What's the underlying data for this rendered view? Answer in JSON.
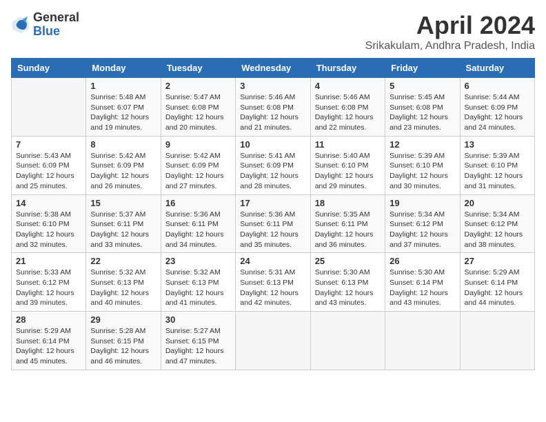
{
  "logo": {
    "general": "General",
    "blue": "Blue"
  },
  "title": "April 2024",
  "subtitle": "Srikakulam, Andhra Pradesh, India",
  "days_of_week": [
    "Sunday",
    "Monday",
    "Tuesday",
    "Wednesday",
    "Thursday",
    "Friday",
    "Saturday"
  ],
  "weeks": [
    [
      {
        "day": "",
        "sunrise": "",
        "sunset": "",
        "daylight": ""
      },
      {
        "day": "1",
        "sunrise": "Sunrise: 5:48 AM",
        "sunset": "Sunset: 6:07 PM",
        "daylight": "Daylight: 12 hours and 19 minutes."
      },
      {
        "day": "2",
        "sunrise": "Sunrise: 5:47 AM",
        "sunset": "Sunset: 6:08 PM",
        "daylight": "Daylight: 12 hours and 20 minutes."
      },
      {
        "day": "3",
        "sunrise": "Sunrise: 5:46 AM",
        "sunset": "Sunset: 6:08 PM",
        "daylight": "Daylight: 12 hours and 21 minutes."
      },
      {
        "day": "4",
        "sunrise": "Sunrise: 5:46 AM",
        "sunset": "Sunset: 6:08 PM",
        "daylight": "Daylight: 12 hours and 22 minutes."
      },
      {
        "day": "5",
        "sunrise": "Sunrise: 5:45 AM",
        "sunset": "Sunset: 6:08 PM",
        "daylight": "Daylight: 12 hours and 23 minutes."
      },
      {
        "day": "6",
        "sunrise": "Sunrise: 5:44 AM",
        "sunset": "Sunset: 6:09 PM",
        "daylight": "Daylight: 12 hours and 24 minutes."
      }
    ],
    [
      {
        "day": "7",
        "sunrise": "Sunrise: 5:43 AM",
        "sunset": "Sunset: 6:09 PM",
        "daylight": "Daylight: 12 hours and 25 minutes."
      },
      {
        "day": "8",
        "sunrise": "Sunrise: 5:42 AM",
        "sunset": "Sunset: 6:09 PM",
        "daylight": "Daylight: 12 hours and 26 minutes."
      },
      {
        "day": "9",
        "sunrise": "Sunrise: 5:42 AM",
        "sunset": "Sunset: 6:09 PM",
        "daylight": "Daylight: 12 hours and 27 minutes."
      },
      {
        "day": "10",
        "sunrise": "Sunrise: 5:41 AM",
        "sunset": "Sunset: 6:09 PM",
        "daylight": "Daylight: 12 hours and 28 minutes."
      },
      {
        "day": "11",
        "sunrise": "Sunrise: 5:40 AM",
        "sunset": "Sunset: 6:10 PM",
        "daylight": "Daylight: 12 hours and 29 minutes."
      },
      {
        "day": "12",
        "sunrise": "Sunrise: 5:39 AM",
        "sunset": "Sunset: 6:10 PM",
        "daylight": "Daylight: 12 hours and 30 minutes."
      },
      {
        "day": "13",
        "sunrise": "Sunrise: 5:39 AM",
        "sunset": "Sunset: 6:10 PM",
        "daylight": "Daylight: 12 hours and 31 minutes."
      }
    ],
    [
      {
        "day": "14",
        "sunrise": "Sunrise: 5:38 AM",
        "sunset": "Sunset: 6:10 PM",
        "daylight": "Daylight: 12 hours and 32 minutes."
      },
      {
        "day": "15",
        "sunrise": "Sunrise: 5:37 AM",
        "sunset": "Sunset: 6:11 PM",
        "daylight": "Daylight: 12 hours and 33 minutes."
      },
      {
        "day": "16",
        "sunrise": "Sunrise: 5:36 AM",
        "sunset": "Sunset: 6:11 PM",
        "daylight": "Daylight: 12 hours and 34 minutes."
      },
      {
        "day": "17",
        "sunrise": "Sunrise: 5:36 AM",
        "sunset": "Sunset: 6:11 PM",
        "daylight": "Daylight: 12 hours and 35 minutes."
      },
      {
        "day": "18",
        "sunrise": "Sunrise: 5:35 AM",
        "sunset": "Sunset: 6:11 PM",
        "daylight": "Daylight: 12 hours and 36 minutes."
      },
      {
        "day": "19",
        "sunrise": "Sunrise: 5:34 AM",
        "sunset": "Sunset: 6:12 PM",
        "daylight": "Daylight: 12 hours and 37 minutes."
      },
      {
        "day": "20",
        "sunrise": "Sunrise: 5:34 AM",
        "sunset": "Sunset: 6:12 PM",
        "daylight": "Daylight: 12 hours and 38 minutes."
      }
    ],
    [
      {
        "day": "21",
        "sunrise": "Sunrise: 5:33 AM",
        "sunset": "Sunset: 6:12 PM",
        "daylight": "Daylight: 12 hours and 39 minutes."
      },
      {
        "day": "22",
        "sunrise": "Sunrise: 5:32 AM",
        "sunset": "Sunset: 6:13 PM",
        "daylight": "Daylight: 12 hours and 40 minutes."
      },
      {
        "day": "23",
        "sunrise": "Sunrise: 5:32 AM",
        "sunset": "Sunset: 6:13 PM",
        "daylight": "Daylight: 12 hours and 41 minutes."
      },
      {
        "day": "24",
        "sunrise": "Sunrise: 5:31 AM",
        "sunset": "Sunset: 6:13 PM",
        "daylight": "Daylight: 12 hours and 42 minutes."
      },
      {
        "day": "25",
        "sunrise": "Sunrise: 5:30 AM",
        "sunset": "Sunset: 6:13 PM",
        "daylight": "Daylight: 12 hours and 43 minutes."
      },
      {
        "day": "26",
        "sunrise": "Sunrise: 5:30 AM",
        "sunset": "Sunset: 6:14 PM",
        "daylight": "Daylight: 12 hours and 43 minutes."
      },
      {
        "day": "27",
        "sunrise": "Sunrise: 5:29 AM",
        "sunset": "Sunset: 6:14 PM",
        "daylight": "Daylight: 12 hours and 44 minutes."
      }
    ],
    [
      {
        "day": "28",
        "sunrise": "Sunrise: 5:29 AM",
        "sunset": "Sunset: 6:14 PM",
        "daylight": "Daylight: 12 hours and 45 minutes."
      },
      {
        "day": "29",
        "sunrise": "Sunrise: 5:28 AM",
        "sunset": "Sunset: 6:15 PM",
        "daylight": "Daylight: 12 hours and 46 minutes."
      },
      {
        "day": "30",
        "sunrise": "Sunrise: 5:27 AM",
        "sunset": "Sunset: 6:15 PM",
        "daylight": "Daylight: 12 hours and 47 minutes."
      },
      {
        "day": "",
        "sunrise": "",
        "sunset": "",
        "daylight": ""
      },
      {
        "day": "",
        "sunrise": "",
        "sunset": "",
        "daylight": ""
      },
      {
        "day": "",
        "sunrise": "",
        "sunset": "",
        "daylight": ""
      },
      {
        "day": "",
        "sunrise": "",
        "sunset": "",
        "daylight": ""
      }
    ]
  ]
}
